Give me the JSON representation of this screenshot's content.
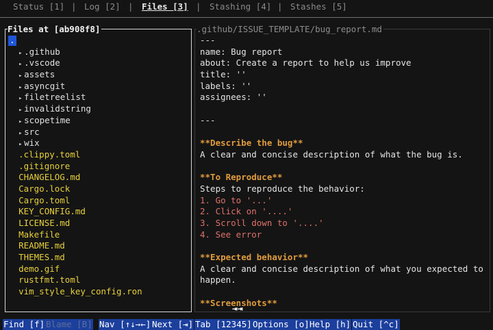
{
  "tabs": [
    {
      "label": "Status [1]",
      "active": false
    },
    {
      "label": "Log [2]",
      "active": false
    },
    {
      "label": "Files [3]",
      "active": true
    },
    {
      "label": "Stashing [4]",
      "active": false
    },
    {
      "label": "Stashes [5]",
      "active": false
    }
  ],
  "tab_separator": "|",
  "tree": {
    "title": "Files at [ab908f8]",
    "root": ".",
    "items": [
      {
        "name": ".github",
        "type": "dir",
        "arrow": "▸"
      },
      {
        "name": ".vscode",
        "type": "dir",
        "arrow": "▸"
      },
      {
        "name": "assets",
        "type": "dir",
        "arrow": "▸"
      },
      {
        "name": "asyncgit",
        "type": "dir",
        "arrow": "▸"
      },
      {
        "name": "filetreelist",
        "type": "dir",
        "arrow": "▸"
      },
      {
        "name": "invalidstring",
        "type": "dir",
        "arrow": "▸"
      },
      {
        "name": "scopetime",
        "type": "dir",
        "arrow": "▸"
      },
      {
        "name": "src",
        "type": "dir",
        "arrow": "▸"
      },
      {
        "name": "wix",
        "type": "dir",
        "arrow": "▸"
      },
      {
        "name": ".clippy.toml",
        "type": "file"
      },
      {
        "name": ".gitignore",
        "type": "file"
      },
      {
        "name": "CHANGELOG.md",
        "type": "file"
      },
      {
        "name": "Cargo.lock",
        "type": "file"
      },
      {
        "name": "Cargo.toml",
        "type": "file"
      },
      {
        "name": "KEY_CONFIG.md",
        "type": "file"
      },
      {
        "name": "LICENSE.md",
        "type": "file"
      },
      {
        "name": "Makefile",
        "type": "file"
      },
      {
        "name": "README.md",
        "type": "file"
      },
      {
        "name": "THEMES.md",
        "type": "file"
      },
      {
        "name": "demo.gif",
        "type": "file"
      },
      {
        "name": "rustfmt.toml",
        "type": "file"
      },
      {
        "name": "vim_style_key_config.ron",
        "type": "file"
      }
    ]
  },
  "preview": {
    "title": ".github/ISSUE_TEMPLATE/bug_report.md",
    "lines": [
      {
        "text": "---",
        "style": "normal"
      },
      {
        "text": "name: Bug report",
        "style": "normal"
      },
      {
        "text": "about: Create a report to help us improve",
        "style": "normal"
      },
      {
        "text": "title: ''",
        "style": "normal"
      },
      {
        "text": "labels: ''",
        "style": "normal"
      },
      {
        "text": "assignees: ''",
        "style": "normal"
      },
      {
        "text": "",
        "style": "normal"
      },
      {
        "text": "---",
        "style": "normal"
      },
      {
        "text": "",
        "style": "normal"
      },
      {
        "text": "**Describe the bug**",
        "style": "heading"
      },
      {
        "text": "A clear and concise description of what the bug is.",
        "style": "normal"
      },
      {
        "text": "",
        "style": "normal"
      },
      {
        "text": "**To Reproduce**",
        "style": "heading"
      },
      {
        "text": "Steps to reproduce the behavior:",
        "style": "normal"
      },
      {
        "text": "1. Go to '...'",
        "style": "red"
      },
      {
        "text": "2. Click on '....'",
        "style": "red"
      },
      {
        "text": "3. Scroll down to '....'",
        "style": "red"
      },
      {
        "text": "4. See error",
        "style": "red"
      },
      {
        "text": "",
        "style": "normal"
      },
      {
        "text": "**Expected behavior**",
        "style": "heading"
      },
      {
        "text": "A clear and concise description of what you expected to",
        "style": "normal"
      },
      {
        "text": "happen.",
        "style": "normal"
      },
      {
        "text": "",
        "style": "normal"
      },
      {
        "text": "**Screenshots**",
        "style": "heading"
      }
    ],
    "scroll_indicator": "⇥⇥"
  },
  "footer": [
    {
      "label": "Find [f]",
      "enabled": true
    },
    {
      "label": "Blame [B]",
      "enabled": false
    },
    {
      "label": "Nav [↑↓→←]",
      "enabled": true
    },
    {
      "label": "Next [⇥]",
      "enabled": true
    },
    {
      "label": "Tab [12345]",
      "enabled": true
    },
    {
      "label": "Options [o]",
      "enabled": true
    },
    {
      "label": "Help [h]",
      "enabled": true
    },
    {
      "label": "Quit [^c]",
      "enabled": true
    }
  ]
}
